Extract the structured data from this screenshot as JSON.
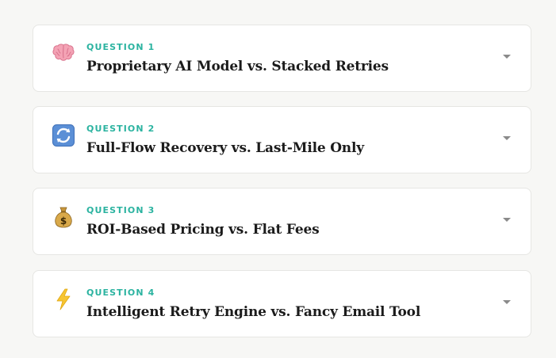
{
  "accent_color": "#2bb3a0",
  "faq": {
    "items": [
      {
        "eyebrow": "QUESTION 1",
        "title": "Proprietary AI Model vs. Stacked Retries",
        "icon": "brain-icon"
      },
      {
        "eyebrow": "QUESTION 2",
        "title": "Full-Flow Recovery vs. Last-Mile Only",
        "icon": "refresh-arrows-icon"
      },
      {
        "eyebrow": "QUESTION 3",
        "title": "ROI-Based Pricing vs. Flat Fees",
        "icon": "money-bag-icon"
      },
      {
        "eyebrow": "QUESTION 4",
        "title": "Intelligent Retry Engine vs. Fancy Email Tool",
        "icon": "lightning-bolt-icon"
      }
    ]
  }
}
